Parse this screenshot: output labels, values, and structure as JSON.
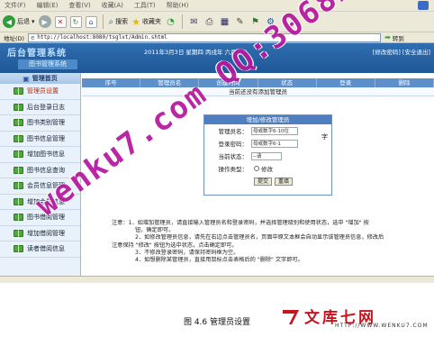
{
  "browser": {
    "menu": [
      "文件(F)",
      "编辑(E)",
      "查看(V)",
      "收藏(A)",
      "工具(T)",
      "帮助(H)"
    ],
    "toolbar": {
      "back": "后退",
      "search": "搜索",
      "favorites": "收藏夹"
    },
    "address_label": "地址(D)",
    "url": "http://localhost:8080/tsglxt/Admin.shtml",
    "go": "转到"
  },
  "header": {
    "logo": "后台管理系统",
    "subtitle": "图书管理系统",
    "date": "2011年3月3日 星期四 丙戌年 六月廿八",
    "links": "[修改密码] [安全退出]"
  },
  "sidebar": {
    "head": "管理首页",
    "items": [
      {
        "label": "管理员设置"
      },
      {
        "label": "后台登录日志"
      },
      {
        "label": "图书类别管理"
      },
      {
        "label": "图书信息管理"
      },
      {
        "label": "增加图书信息"
      },
      {
        "label": "图书信息查询"
      },
      {
        "label": "会员信息管理"
      },
      {
        "label": "增加会员信息"
      },
      {
        "label": "图书借阅管理"
      },
      {
        "label": "增加借阅管理"
      },
      {
        "label": "读者借阅信息"
      }
    ]
  },
  "grid": {
    "columns": [
      "序号",
      "管理员名",
      "创建时间",
      "状态",
      "登录",
      "删除"
    ],
    "empty": "当前还没有添加管理员"
  },
  "form": {
    "title": "增加/修改管理员",
    "name_label": "管理员名：",
    "name_value": "母或数字6-10位",
    "pwd_label": "登录密码：",
    "pwd_value": "母或数字6-1",
    "status_label": "当前状态：",
    "status_value": "--请",
    "op_label": "操作类型：",
    "op_option": "修改",
    "btn_submit": "提交",
    "btn_reset": "重填",
    "side_text": "字"
  },
  "notes": [
    "注意：1．如增加管理员，请直接输入管理员名和登录密码，并选择管理级别和使用状态，选中 \"增加\" 按",
    "钮，确定即可。",
    "2．如修改管理员信息，请先在右边点击管理员名，页面中原文本框会自动显示该管理员信息，修改后",
    "注意保持 \"修改\" 按钮为选中状态，点击确定即可。",
    "3．不修改登录密码，请保持密码框为空。",
    "4．如想删除某管理员，直接用鼠标点击表格后的 \"删除\" 文字即可。"
  ],
  "caption": "图 4.6 管理员设置",
  "brand": {
    "name": "文库七网",
    "url": "HTTP://WWW.WENKU7.COM"
  },
  "watermark": "wenku7.com  QQ:306826066",
  "colors": {
    "header_blue": "#2f6eb0",
    "grid_head": "#5d8fc9",
    "active_item": "#cc2200",
    "watermark": "#b5179e",
    "brand_red": "#c8141e"
  }
}
